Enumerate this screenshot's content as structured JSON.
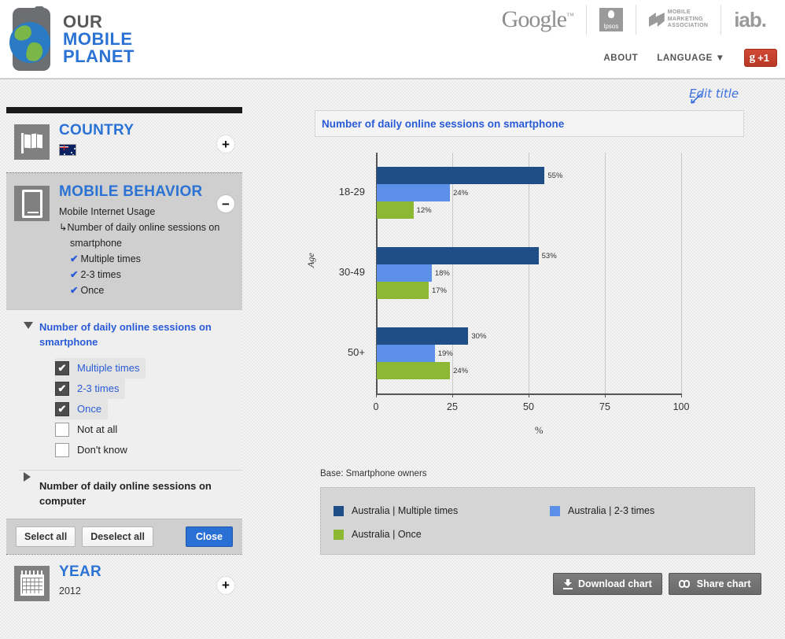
{
  "header": {
    "logo": {
      "line1": "OUR",
      "line2": "MOBILE",
      "line3": "PLANET"
    },
    "partners": [
      {
        "name": "google-logo",
        "label": "Google"
      },
      {
        "name": "ipsos-logo",
        "label": "Ipsos"
      },
      {
        "name": "mma-logo",
        "label_line1": "MOBILE",
        "label_line2": "MARKETING",
        "label_line3": "ASSOCIATION"
      },
      {
        "name": "iab-logo",
        "label": "iab."
      }
    ],
    "nav": [
      {
        "label": "ABOUT"
      },
      {
        "label": "LANGUAGE ▼"
      }
    ],
    "plusone": {
      "g": "g",
      "label": "+1"
    }
  },
  "sidebar": {
    "country": {
      "title": "COUNTRY",
      "toggle": "+",
      "flag_alt": "Australia"
    },
    "behavior": {
      "title": "MOBILE BEHAVIOR",
      "toggle": "−",
      "lines": [
        {
          "text": "Mobile Internet Usage",
          "indent": 0,
          "check": false
        },
        {
          "text": "↳Number of daily online sessions on",
          "indent": 0,
          "check": false
        },
        {
          "text": "smartphone",
          "indent": 1,
          "check": false
        },
        {
          "text": "Multiple times",
          "indent": 1,
          "check": true
        },
        {
          "text": "2-3 times",
          "indent": 1,
          "check": true
        },
        {
          "text": "Once",
          "indent": 1,
          "check": true
        }
      ],
      "check_glyph": "✔"
    },
    "dropdown": {
      "group1_title": "Number of daily online sessions on smartphone",
      "options": [
        {
          "label": "Multiple times",
          "checked": true
        },
        {
          "label": "2-3 times",
          "checked": true
        },
        {
          "label": "Once",
          "checked": true
        },
        {
          "label": "Not at all",
          "checked": false
        },
        {
          "label": "Don't know",
          "checked": false
        }
      ],
      "group2_title": "Number of daily online sessions on computer",
      "select_all": "Select all",
      "deselect_all": "Deselect all",
      "close": "Close",
      "check_glyph": "✔"
    },
    "year": {
      "title": "YEAR",
      "value": "2012",
      "toggle": "+"
    }
  },
  "chart_panel": {
    "edit_title": "Edit title",
    "title": "Number of daily online sessions on smartphone",
    "base_text": "Base: Smartphone owners",
    "download_label": "Download chart",
    "share_label": "Share chart"
  },
  "chart_data": {
    "type": "bar",
    "orientation": "horizontal",
    "title": "Number of daily online sessions on smartphone",
    "xlabel": "%",
    "ylabel": "Age",
    "categories": [
      "18-29",
      "30-49",
      "50+"
    ],
    "xlim": [
      0,
      100
    ],
    "xticks": [
      0,
      25,
      50,
      75,
      100
    ],
    "grid": true,
    "legend_position": "bottom",
    "series": [
      {
        "name": "Australia | Multiple times",
        "color": "#1F4E87",
        "values": [
          55,
          53,
          30
        ],
        "labels": [
          "55%",
          "53%",
          "30%"
        ]
      },
      {
        "name": "Australia | 2-3 times",
        "color": "#5C8FE8",
        "values": [
          24,
          18,
          19
        ],
        "labels": [
          "24%",
          "18%",
          "19%"
        ]
      },
      {
        "name": "Australia | Once",
        "color": "#8CB833",
        "values": [
          12,
          17,
          24
        ],
        "labels": [
          "12%",
          "17%",
          "24%"
        ]
      }
    ]
  }
}
